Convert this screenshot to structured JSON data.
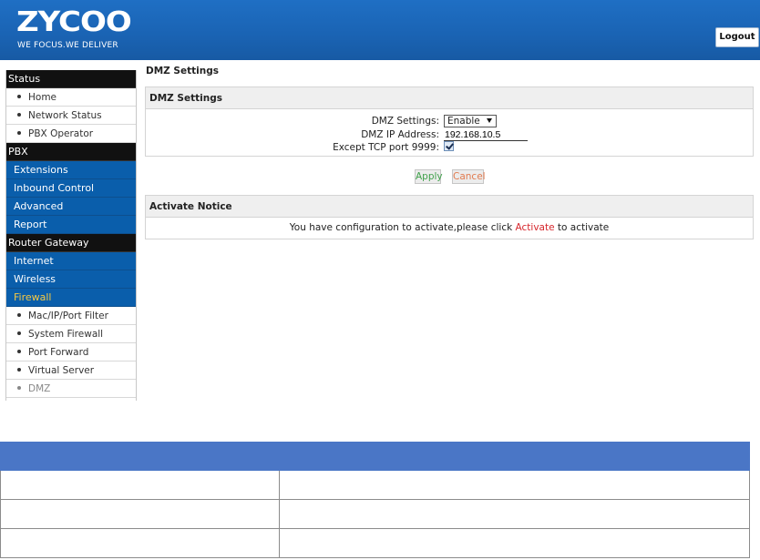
{
  "header": {
    "logo_text": "ZYCOO",
    "tagline": "WE FOCUS.WE DELIVER",
    "logout_label": "Logout",
    "bg_color": "#1a63b3"
  },
  "sidebar": {
    "items": [
      {
        "type": "section",
        "label": "Status"
      },
      {
        "type": "sub",
        "label": "Home"
      },
      {
        "type": "sub",
        "label": "Network Status"
      },
      {
        "type": "sub",
        "label": "PBX Operator"
      },
      {
        "type": "section",
        "label": "PBX"
      },
      {
        "type": "nav",
        "label": "Extensions"
      },
      {
        "type": "nav",
        "label": "Inbound Control"
      },
      {
        "type": "nav",
        "label": "Advanced"
      },
      {
        "type": "nav",
        "label": "Report"
      },
      {
        "type": "section",
        "label": "Router Gateway"
      },
      {
        "type": "nav",
        "label": "Internet"
      },
      {
        "type": "nav",
        "label": "Wireless"
      },
      {
        "type": "nav",
        "label": "Firewall",
        "active": true
      },
      {
        "type": "sub",
        "label": "Mac/IP/Port Filter"
      },
      {
        "type": "sub",
        "label": "System Firewall"
      },
      {
        "type": "sub",
        "label": "Port Forward"
      },
      {
        "type": "sub",
        "label": "Virtual Server"
      },
      {
        "type": "sub",
        "label": "DMZ",
        "current": true
      }
    ],
    "colors": {
      "section": "#111111",
      "nav": "#0a5eab",
      "active_text": "#f5c842"
    }
  },
  "main": {
    "page_title": "DMZ Settings",
    "settings_panel": {
      "title": "DMZ Settings",
      "dmz_settings_label": "DMZ Settings:",
      "dmz_settings_value": "Enable",
      "dmz_ip_label": "DMZ IP Address:",
      "dmz_ip_value": "192.168.10.5",
      "except_tcp_label": "Except TCP port 9999:",
      "except_tcp_checked": true
    },
    "buttons": {
      "apply_label": "Apply",
      "cancel_label": "Cancel"
    },
    "notice_panel": {
      "title": "Activate Notice",
      "text_before": "You have configuration to activate,please click ",
      "link_text": "Activate",
      "text_after": " to activate"
    }
  },
  "bottom_table": {
    "header_color": "#4a76c6",
    "rows": 3
  }
}
